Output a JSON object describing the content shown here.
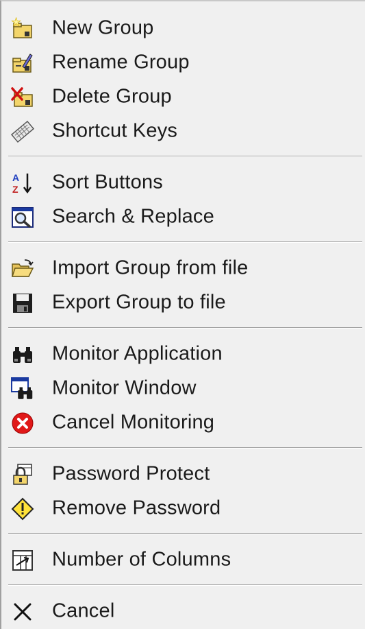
{
  "menu": {
    "groups": [
      [
        {
          "label": "New Group",
          "icon": "new-group-icon"
        },
        {
          "label": "Rename Group",
          "icon": "rename-group-icon"
        },
        {
          "label": "Delete Group",
          "icon": "delete-group-icon"
        },
        {
          "label": "Shortcut Keys",
          "icon": "keyboard-icon"
        }
      ],
      [
        {
          "label": "Sort Buttons",
          "icon": "sort-az-icon"
        },
        {
          "label": "Search & Replace",
          "icon": "search-replace-icon"
        }
      ],
      [
        {
          "label": "Import Group from file",
          "icon": "open-folder-icon"
        },
        {
          "label": "Export Group to file",
          "icon": "floppy-disk-icon"
        }
      ],
      [
        {
          "label": "Monitor Application",
          "icon": "binoculars-icon"
        },
        {
          "label": "Monitor Window",
          "icon": "window-binoculars-icon"
        },
        {
          "label": "Cancel Monitoring",
          "icon": "red-cancel-icon"
        }
      ],
      [
        {
          "label": "Password Protect",
          "icon": "lock-icon"
        },
        {
          "label": "Remove Password",
          "icon": "warning-diamond-icon"
        }
      ],
      [
        {
          "label": "Number of Columns",
          "icon": "columns-icon"
        }
      ],
      [
        {
          "label": "Cancel",
          "icon": "close-x-icon"
        }
      ]
    ]
  }
}
